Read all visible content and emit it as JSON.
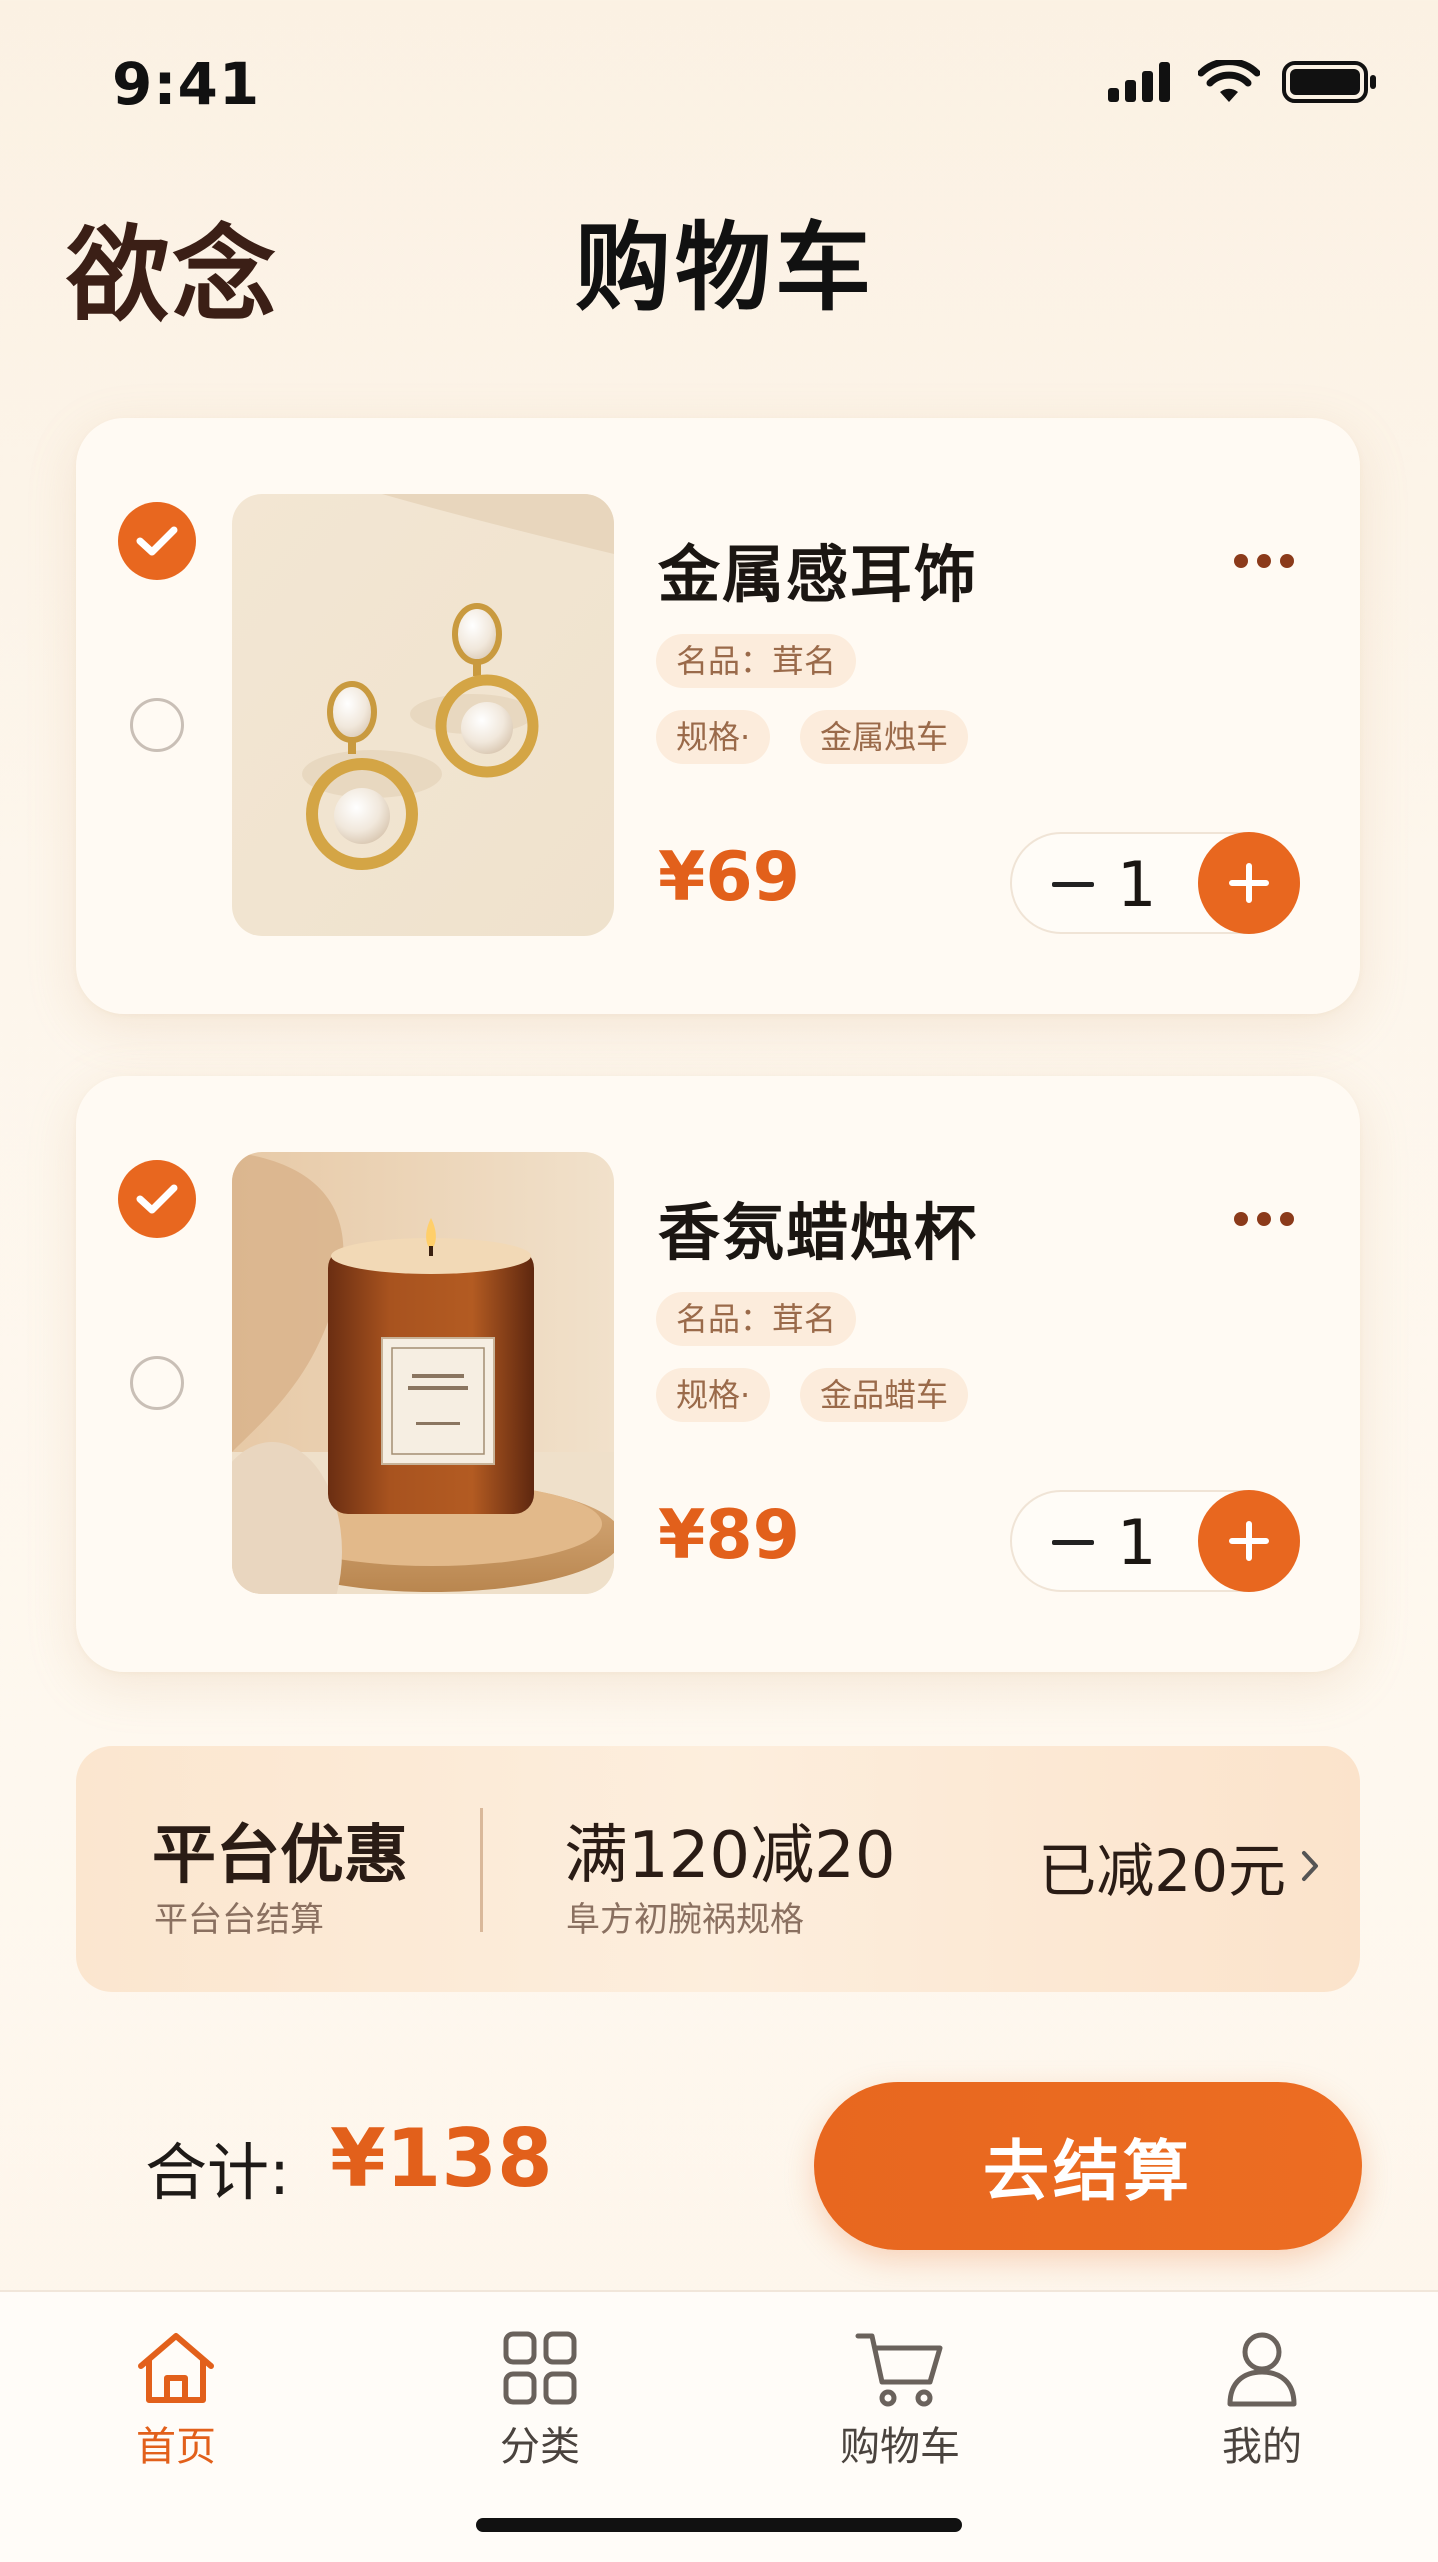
{
  "status_bar": {
    "time": "9:41"
  },
  "header": {
    "brand": "欲念",
    "title": "购物车"
  },
  "cart": {
    "items": [
      {
        "name": "金属感耳饰",
        "chip_name": "名品：茸名",
        "chip_spec_label": "规格·",
        "chip_spec_value": "金属烛车",
        "price": "¥69",
        "quantity": "1",
        "selected": true,
        "image": "pearl-earrings-photo"
      },
      {
        "name": "香氛蜡烛杯",
        "chip_name": "名品：茸名",
        "chip_spec_label": "规格·",
        "chip_spec_value": "金品蜡车",
        "price": "¥89",
        "quantity": "1",
        "selected": true,
        "image": "amber-candle-photo"
      }
    ]
  },
  "promo": {
    "title": "平台优惠",
    "subtitle": "平台台结算",
    "deal": "满120减20",
    "deal_sub": "阜方初腕祸规格",
    "saved": "已减20元"
  },
  "summary": {
    "total_label": "合计:",
    "total_value": "¥138",
    "checkout_label": "去结算"
  },
  "tabbar": {
    "items": [
      {
        "label": "首页",
        "icon": "home-icon",
        "active": true
      },
      {
        "label": "分类",
        "icon": "grid-icon",
        "active": false
      },
      {
        "label": "购物车",
        "icon": "cart-icon",
        "active": false
      },
      {
        "label": "我的",
        "icon": "user-icon",
        "active": false
      }
    ]
  },
  "colors": {
    "accent": "#e8671f",
    "price": "#e2601b",
    "background": "#fdf6ec",
    "brand": "#3b1f16"
  }
}
